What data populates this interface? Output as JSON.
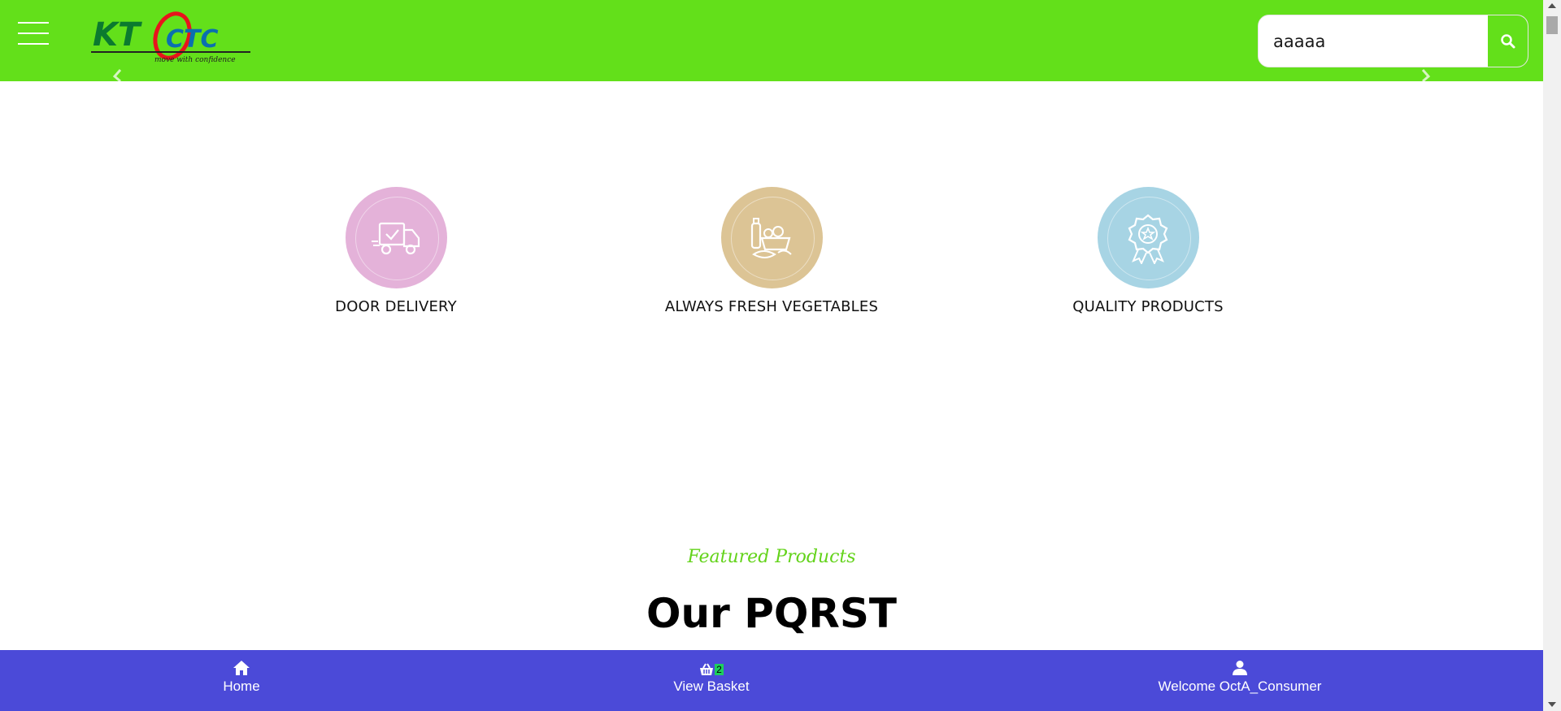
{
  "header": {
    "logo_text": "KTCTC",
    "logo_tagline": "move with confidence",
    "background": "#63e01a"
  },
  "search": {
    "value": "aaaaa",
    "button_icon": "search-icon"
  },
  "features": [
    {
      "label": "DOOR DELIVERY",
      "icon": "delivery-truck-icon",
      "color": "#e4b2d9"
    },
    {
      "label": "ALWAYS FRESH VEGETABLES",
      "icon": "vegetables-basket-icon",
      "color": "#dcc495"
    },
    {
      "label": "QUALITY PRODUCTS",
      "icon": "quality-badge-icon",
      "color": "#a7d4e4"
    }
  ],
  "featured": {
    "subtitle": "Featured Products",
    "title": "Our PQRST"
  },
  "bottom_nav": {
    "background": "#4b4ad8",
    "home_label": "Home",
    "basket_label": "View Basket",
    "basket_count": "2",
    "user_label": "Welcome OctA_Consumer"
  }
}
